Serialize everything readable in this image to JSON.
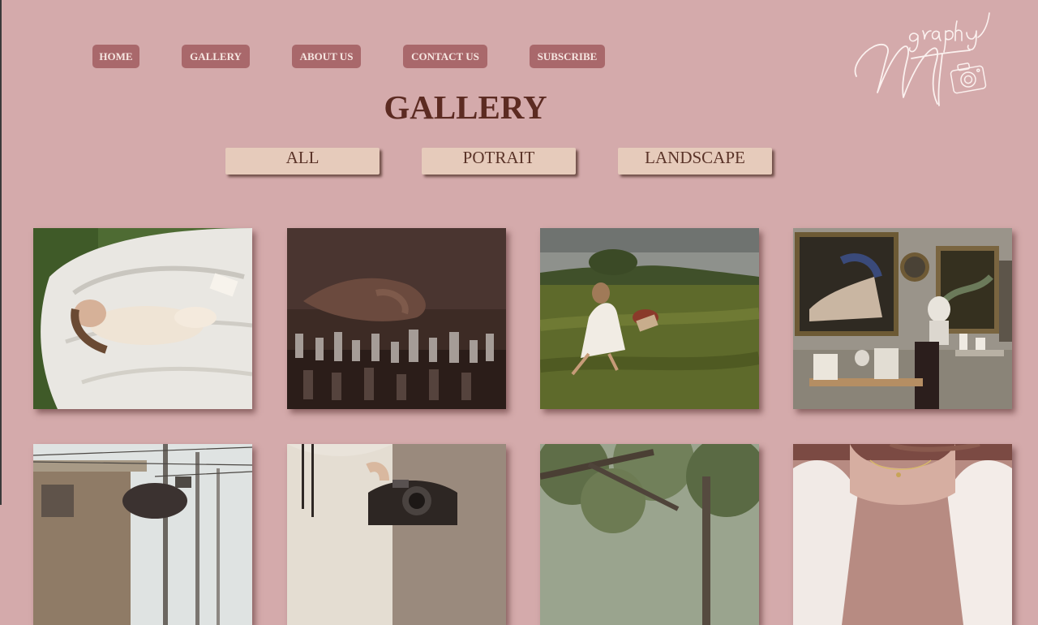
{
  "nav": {
    "items": [
      {
        "label": "HOME"
      },
      {
        "label": "GALLERY"
      },
      {
        "label": "ABOUT US"
      },
      {
        "label": "CONTACT US"
      },
      {
        "label": "SUBSCRIBE"
      }
    ]
  },
  "logo": {
    "text": "graphy",
    "monogram": "MT",
    "icon": "camera-icon"
  },
  "page": {
    "title": "GALLERY"
  },
  "filters": [
    {
      "label": "ALL"
    },
    {
      "label": "POTRAIT"
    },
    {
      "label": "LANDSCAPE"
    }
  ],
  "colors": {
    "background": "#d4aaab",
    "nav_button": "#a9686b",
    "nav_text": "#f6e6e1",
    "title": "#5c2b22",
    "filter_button": "#e6cbbb",
    "filter_text": "#5a3328"
  },
  "photos": [
    {
      "subject": "woman-sleeping-on-white-sheet"
    },
    {
      "subject": "hand-moving-chess-piece"
    },
    {
      "subject": "woman-running-in-field"
    },
    {
      "subject": "gallery-room-with-paintings-and-bust"
    },
    {
      "subject": "street-with-power-lines"
    },
    {
      "subject": "person-holding-camera"
    },
    {
      "subject": "trees-forest"
    },
    {
      "subject": "woman-in-white-blouse"
    }
  ]
}
